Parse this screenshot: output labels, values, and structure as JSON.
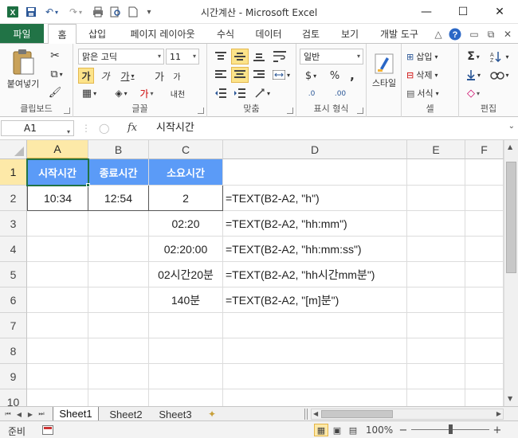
{
  "window": {
    "title": "시간계산  -  Microsoft Excel",
    "controls": {
      "minimize": "—",
      "restore": "☐",
      "close": "✕"
    }
  },
  "quick_access": {
    "save": "💾",
    "undo": "↶",
    "redo": "↷",
    "print": "🖶",
    "preview": "🔍",
    "new": "🗋",
    "customize": "▾"
  },
  "tabs": {
    "file": "파일",
    "items": [
      "홈",
      "삽입",
      "페이지 레이아웃",
      "수식",
      "데이터",
      "검토",
      "보기",
      "개발 도구"
    ],
    "active": "홈",
    "right_icons": {
      "collapse": "△",
      "help": "?",
      "min": "▭",
      "restore": "⧉",
      "close": "✕"
    }
  },
  "ribbon": {
    "clipboard": {
      "label": "클립보드",
      "paste": "붙여넣기",
      "paste_icon": "📋",
      "cut": "✂",
      "copy": "⧉",
      "format_painter": "🖌"
    },
    "font": {
      "label": "글꼴",
      "font_name": "맑은 고딕",
      "font_size": "11",
      "bold": "가",
      "italic": "가",
      "underline": "가",
      "grow": "가",
      "shrink": "가",
      "border": "▦",
      "fill": "◈",
      "color": "가",
      "phonetic": "내천"
    },
    "alignment": {
      "label": "맞춤"
    },
    "number": {
      "label": "표시 형식",
      "format": "일반",
      "currency": "$",
      "percent": "%",
      "comma": ",",
      "inc": ".0",
      "dec": ".00"
    },
    "styles": {
      "label": "스타일"
    },
    "cells": {
      "label": "셀",
      "insert": "삽입",
      "delete": "삭제",
      "format": "서식"
    },
    "editing": {
      "label": "편집",
      "sum": "Σ",
      "sort": "정렬",
      "find": "찾기",
      "clear": "◇"
    }
  },
  "formula_bar": {
    "name_box": "A1",
    "fx": "fx",
    "content": "시작시간"
  },
  "grid": {
    "columns": [
      "A",
      "B",
      "C",
      "D",
      "E",
      "F"
    ],
    "rows": [
      "1",
      "2",
      "3",
      "4",
      "5",
      "6",
      "7",
      "8",
      "9",
      "10"
    ],
    "cells": {
      "A1": "시작시간",
      "B1": "종료시간",
      "C1": "소요시간",
      "A2": "10:34",
      "B2": "12:54",
      "C2": "2",
      "D2": "=TEXT(B2-A2, \"h\")",
      "C3": "02:20",
      "D3": "=TEXT(B2-A2, \"hh:mm\")",
      "C4": "02:20:00",
      "D4": "=TEXT(B2-A2, \"hh:mm:ss\")",
      "C5": "02시간20분",
      "D5": "=TEXT(B2-A2, \"hh시간mm분\")",
      "C6": "140분",
      "D6": "=TEXT(B2-A2, \"[m]분\")"
    },
    "header_fill": "#5b9bf7",
    "selected_cell": "A1"
  },
  "sheets": {
    "tabs": [
      "Sheet1",
      "Sheet2",
      "Sheet3"
    ],
    "active": "Sheet1",
    "new_sheet_icon": "✦"
  },
  "status": {
    "mode": "준비",
    "zoom": "100%",
    "zoom_out": "−",
    "zoom_in": "+"
  }
}
